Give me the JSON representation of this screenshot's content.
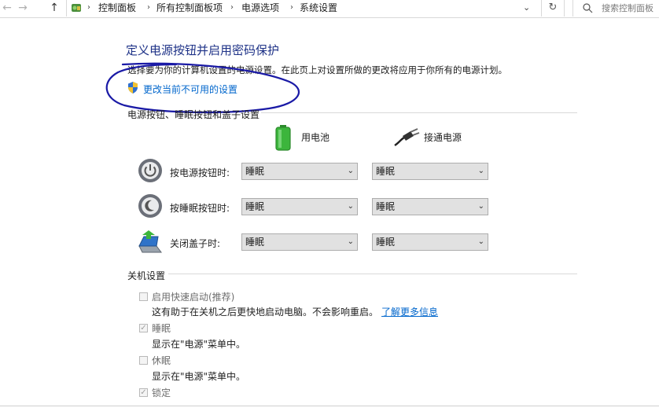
{
  "address_bar": {
    "breadcrumbs": [
      "控制面板",
      "所有控制面板项",
      "电源选项",
      "系统设置"
    ],
    "search_placeholder": "搜索控制面板"
  },
  "page": {
    "title": "定义电源按钮并启用密码保护",
    "description": "选择要为你的计算机设置的电源设置。在此页上对设置所做的更改将应用于你所有的电源计划。",
    "change_link": "更改当前不可用的设置"
  },
  "power_section": {
    "title": "电源按钮、睡眠按钮和盖子设置",
    "columns": {
      "battery": "用电池",
      "plugged_in": "接通电源"
    },
    "rows": [
      {
        "label": "按电源按钮时:",
        "battery": "睡眠",
        "plugged_in": "睡眠"
      },
      {
        "label": "按睡眠按钮时:",
        "battery": "睡眠",
        "plugged_in": "睡眠"
      },
      {
        "label": "关闭盖子时:",
        "battery": "睡眠",
        "plugged_in": "睡眠"
      }
    ]
  },
  "shutdown_section": {
    "title": "关机设置",
    "options": [
      {
        "label": "启用快速启动(推荐)",
        "checked": false,
        "desc": "这有助于在关机之后更快地启动电脑。不会影响重启。",
        "link": "了解更多信息"
      },
      {
        "label": "睡眠",
        "checked": true,
        "desc": "显示在\"电源\"菜单中。"
      },
      {
        "label": "休眠",
        "checked": false,
        "desc": "显示在\"电源\"菜单中。"
      },
      {
        "label": "锁定",
        "checked": true
      }
    ]
  },
  "colors": {
    "title": "#1e3287",
    "link": "#0066cc",
    "annotation": "#1a1aa6",
    "battery_green": "#3cb53c"
  }
}
